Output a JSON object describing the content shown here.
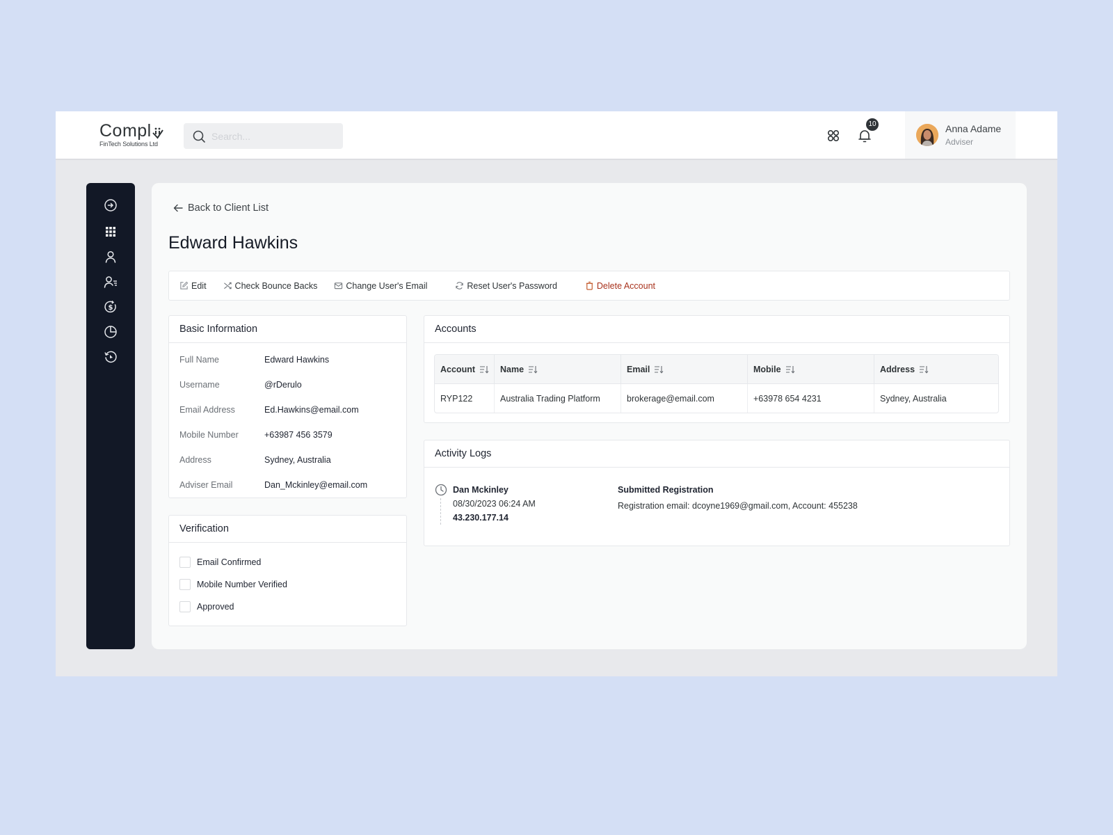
{
  "brand": {
    "name": "Compl",
    "tagline": "FinTech Solutions Ltd"
  },
  "search": {
    "placeholder": "Search...",
    "value": ""
  },
  "header": {
    "apps_icon": "apps-grid-icon",
    "notifications": {
      "icon": "bell-icon",
      "count": "10"
    },
    "user": {
      "name": "Anna Adame",
      "role": "Adviser"
    }
  },
  "sidebar": {
    "items": [
      {
        "icon": "arrow-right-circle-icon"
      },
      {
        "icon": "grid-icon"
      },
      {
        "icon": "user-icon"
      },
      {
        "icon": "user-list-icon"
      },
      {
        "icon": "currency-cycle-icon"
      },
      {
        "icon": "pie-chart-icon"
      },
      {
        "icon": "history-icon"
      }
    ]
  },
  "page": {
    "back_label": "Back to Client List",
    "title": "Edward Hawkins"
  },
  "actions": {
    "edit": "Edit",
    "bounce": "Check Bounce Backs",
    "change_email": "Change User's Email",
    "reset_password": "Reset User's Password",
    "delete": "Delete Account",
    "danger_color": "#a8321c"
  },
  "basic_info": {
    "title": "Basic Information",
    "rows": [
      {
        "label": "Full Name",
        "value": "Edward Hawkins"
      },
      {
        "label": "Username",
        "value": "@rDerulo"
      },
      {
        "label": "Email Address",
        "value": "Ed.Hawkins@email.com"
      },
      {
        "label": "Mobile Number",
        "value": "+63987 456 3579"
      },
      {
        "label": "Address",
        "value": "Sydney, Australia"
      },
      {
        "label": "Adviser Email",
        "value": "Dan_Mckinley@email.com"
      }
    ]
  },
  "verification": {
    "title": "Verification",
    "items": [
      {
        "label": "Email Confirmed",
        "checked": false
      },
      {
        "label": "Mobile Number Verified",
        "checked": false
      },
      {
        "label": "Approved",
        "checked": false
      }
    ]
  },
  "accounts": {
    "title": "Accounts",
    "columns": [
      "Account",
      "Name",
      "Email",
      "Mobile",
      "Address"
    ],
    "rows": [
      [
        "RYP122",
        "Australia Trading Platform",
        "brokerage@email.com",
        "+63978 654 4231",
        "Sydney, Australia"
      ]
    ]
  },
  "activity": {
    "title": "Activity Logs",
    "entries": [
      {
        "user": "Dan Mckinley",
        "timestamp": "08/30/2023 06:24 AM",
        "ip": "43.230.177.14",
        "action": "Submitted Registration",
        "detail": "Registration email: dcoyne1969@gmail.com, Account: 455238"
      }
    ]
  }
}
